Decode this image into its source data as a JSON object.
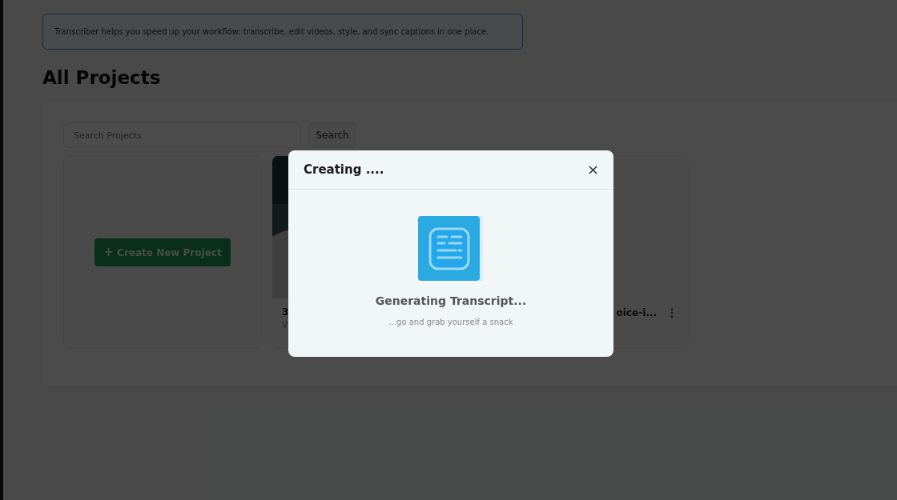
{
  "banner": "Transcriber helps you speed up your workflow: transcribe, edit videos, style, and sync captions in one place.",
  "heading": "All Projects",
  "search": {
    "placeholder": "Search Projects",
    "button": "Search"
  },
  "create_button": {
    "icon": "+",
    "label": "Create New Project"
  },
  "projects": [
    {
      "kind": "picture",
      "title": "3",
      "meta": "V"
    },
    {
      "kind": "plain",
      "title": "oice-i...",
      "menu": "⋮"
    }
  ],
  "modal": {
    "title": "Creating ....",
    "status": "Generating Transcript...",
    "hint": "...go and grab yourself a snack"
  }
}
